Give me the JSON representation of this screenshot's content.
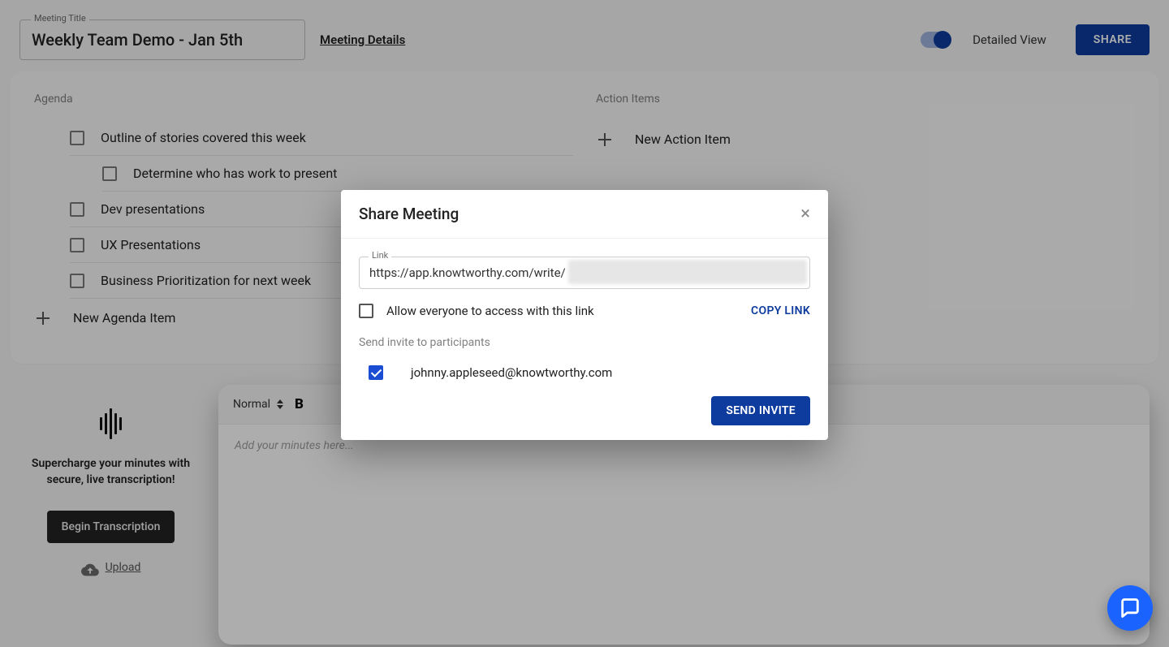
{
  "header": {
    "title_label": "Meeting Title",
    "title_value": "Weekly Team Demo - Jan 5th",
    "details_link": "Meeting Details",
    "toggle_label": "Detailed View",
    "share_button": "SHARE"
  },
  "agenda": {
    "title": "Agenda",
    "items": [
      {
        "text": "Outline of stories covered this week",
        "nested": false
      },
      {
        "text": "Determine who has work to present",
        "nested": true
      },
      {
        "text": "Dev presentations",
        "nested": false
      },
      {
        "text": "UX Presentations",
        "nested": false
      },
      {
        "text": "Business Prioritization for next week",
        "nested": false
      }
    ],
    "new_label": "New Agenda Item"
  },
  "action_items": {
    "title": "Action Items",
    "new_label": "New Action Item"
  },
  "transcription": {
    "promo_line1": "Supercharge your minutes with",
    "promo_line2": "secure, live transcription!",
    "begin_button": "Begin Transcription",
    "upload_label": "Upload"
  },
  "editor": {
    "style_select": "Normal",
    "bold_label": "B",
    "placeholder": "Add your minutes here..."
  },
  "modal": {
    "title": "Share Meeting",
    "link_label": "Link",
    "link_value": "https://app.knowtworthy.com/write/",
    "allow_label": "Allow everyone to access with this link",
    "copy_link": "COPY LINK",
    "invite_label": "Send invite to participants",
    "participant_email": "johnny.appleseed@knowtworthy.com",
    "send_button": "SEND INVITE"
  },
  "colors": {
    "primary": "#0d3c9e",
    "accent": "#1a63ff"
  }
}
